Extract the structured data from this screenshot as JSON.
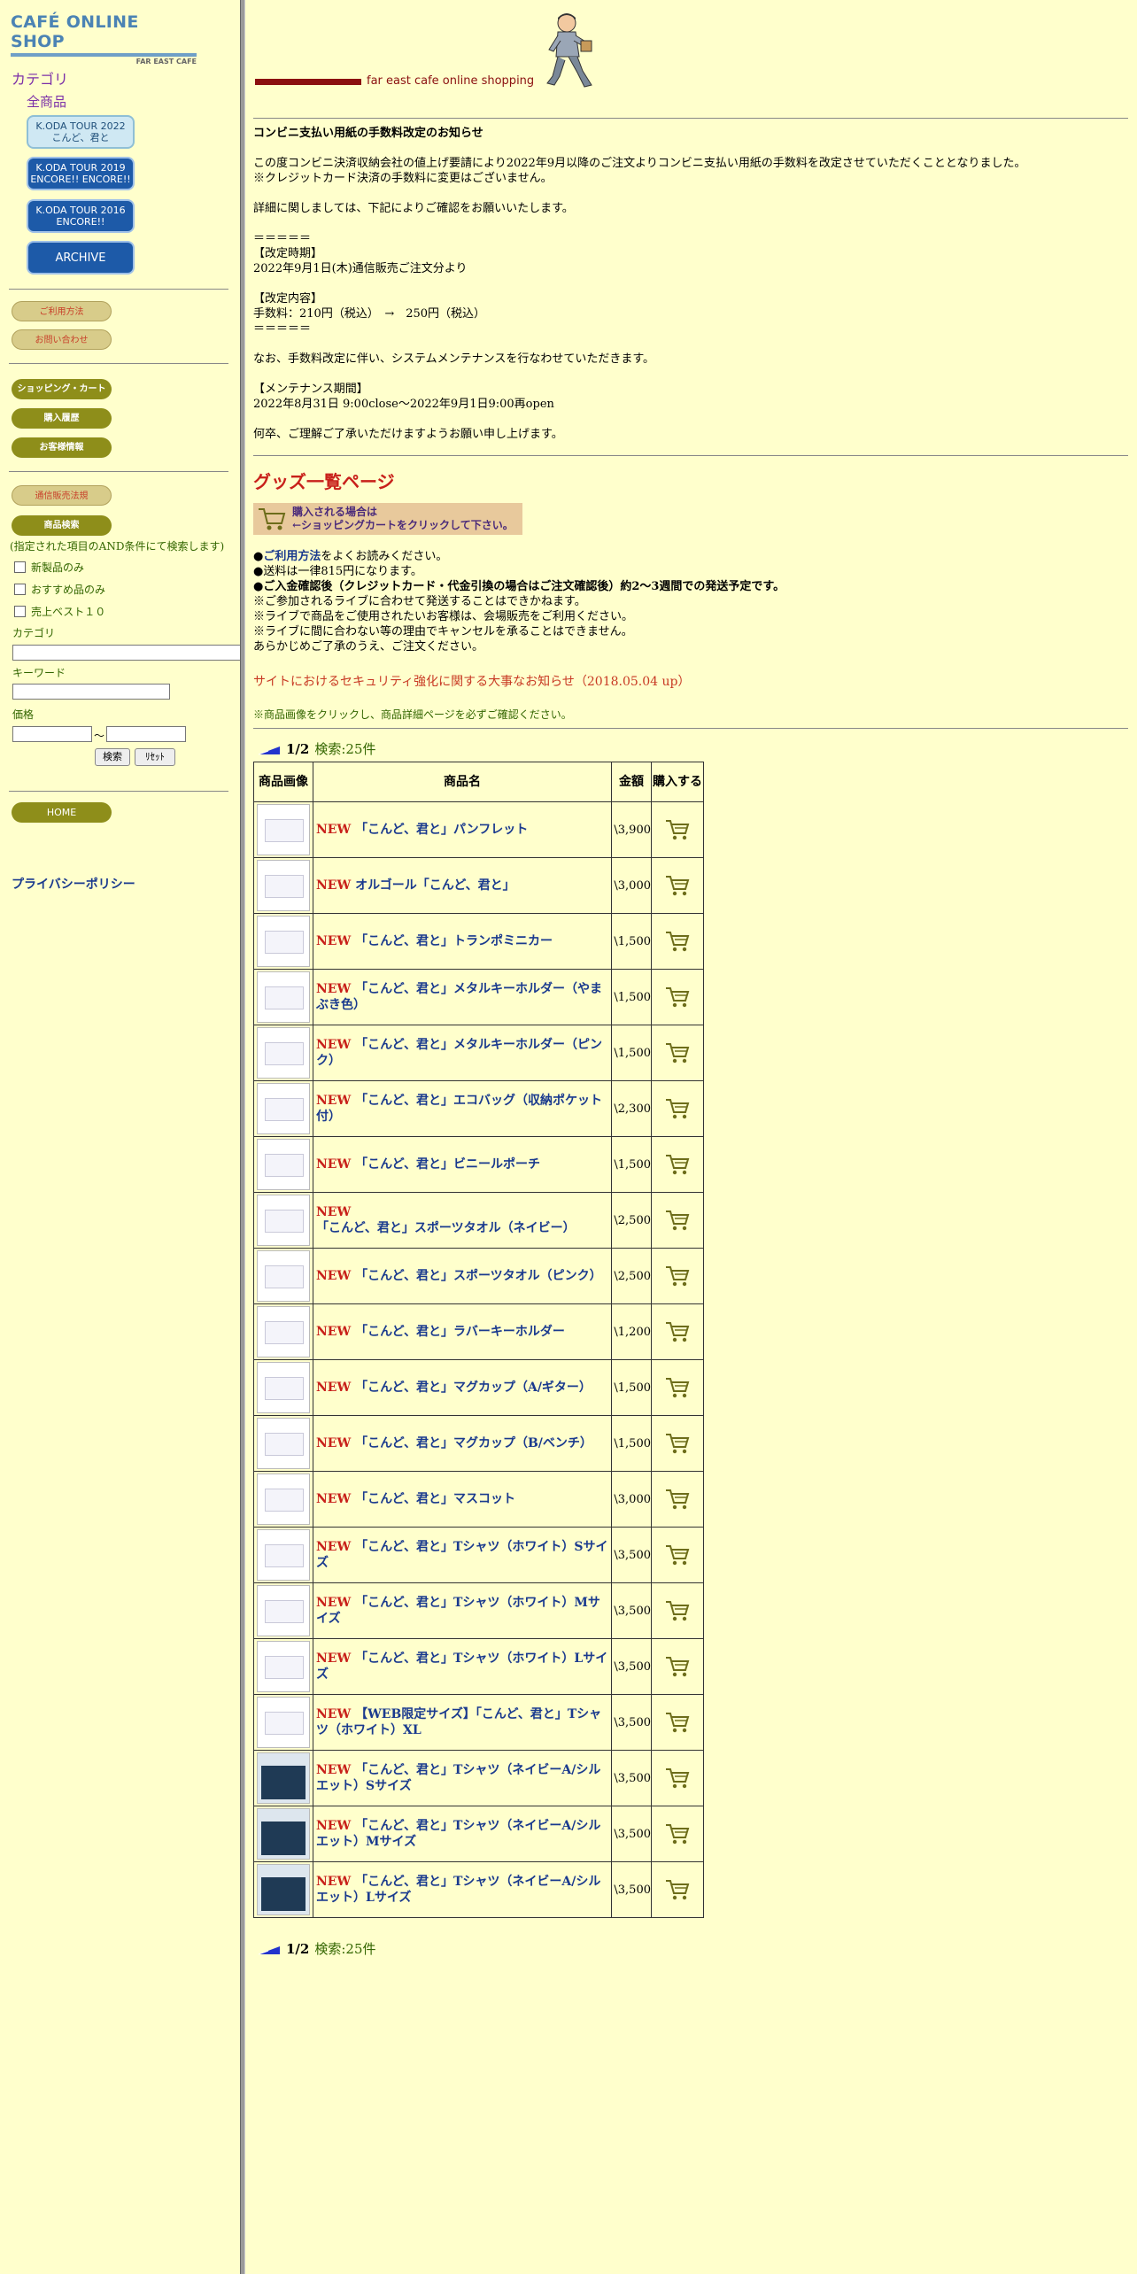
{
  "site": {
    "title": "CAFÉ ONLINE SHOP",
    "subtitle": "FAR EAST CAFE"
  },
  "sidebar": {
    "category_heading": "カテゴリ",
    "all_items": "全商品",
    "tours": [
      {
        "line1": "K.ODA TOUR 2022",
        "line2": "こんど、君と"
      },
      {
        "line1": "K.ODA TOUR 2019",
        "line2": "ENCORE!! ENCORE!!"
      },
      {
        "line1": "K.ODA TOUR 2016",
        "line2": "ENCORE!!"
      },
      {
        "line1": "ARCHIVE",
        "line2": ""
      }
    ],
    "usage": "ご利用方法",
    "contact": "お問い合わせ",
    "cart": "ショッピング・カート",
    "history": "購入履歴",
    "customer": "お客様情報",
    "law": "通信販売法規",
    "search_title": "商品検索",
    "search_note": "(指定された項目のAND条件にて検索します)",
    "checks": [
      "新製品のみ",
      "おすすめ品のみ",
      "売上ベスト１０"
    ],
    "category_label": "カテゴリ",
    "keyword_label": "キーワード",
    "price_label": "価格",
    "tilde": "～",
    "search_btn": "検索",
    "reset_btn": "ﾘｾｯﾄ",
    "home": "HOME",
    "privacy": "プライバシーポリシー"
  },
  "header": {
    "banner_text": "far east cafe online shopping"
  },
  "notice": {
    "title": "コンビニ支払い用紙の手数料改定のお知らせ",
    "lines": [
      "この度コンビニ決済収納会社の値上げ要請により2022年9月以降のご注文よりコンビニ支払い用紙の手数料を改定させていただくこととなりました。",
      "※クレジットカード決済の手数料に変更はございません。",
      "",
      "詳細に関しましては、下記によりご確認をお願いいたします。",
      "",
      "＝＝＝＝＝",
      "【改定時期】",
      "2022年9月1日(木)通信販売ご注文分より",
      "",
      "【改定内容】",
      "手数料：210円（税込）　→　250円（税込）",
      "＝＝＝＝＝",
      "",
      "なお、手数料改定に伴い、システムメンテナンスを行なわせていただきます。",
      "",
      "【メンテナンス期間】",
      "2022年8月31日 9:00close～2022年9月1日9:00再open",
      "",
      "何卒、ご理解ご了承いただけますようお願い申し上げます。"
    ]
  },
  "goods": {
    "heading": "グッズ一覧ページ",
    "cart_note1": "購入される場合は",
    "cart_note2": "←ショッピングカートをクリックして下さい。",
    "info": [
      {
        "pre": "●",
        "link": "ご利用方法",
        "post": "をよくお読みください。",
        "bold": false
      },
      {
        "pre": "●",
        "link": "",
        "post": "送料は一律815円になります。",
        "bold": false
      },
      {
        "pre": "●",
        "link": "",
        "post": "ご入金確認後（クレジットカード・代金引換の場合はご注文確認後）約2～3週間での発送予定です。",
        "bold": true
      },
      {
        "pre": "",
        "link": "",
        "post": "※ご参加されるライブに合わせて発送することはできかねます。",
        "bold": false
      },
      {
        "pre": "",
        "link": "",
        "post": "※ライブで商品をご使用されたいお客様は、会場販売をご利用ください。",
        "bold": false
      },
      {
        "pre": "",
        "link": "",
        "post": "※ライブに間に合わない等の理由でキャンセルを承ることはできません。",
        "bold": false
      },
      {
        "pre": "",
        "link": "",
        "post": "あらかじめご了承のうえ、ご注文ください。",
        "bold": false
      }
    ],
    "security": "サイトにおけるセキュリティ強化に関する大事なお知らせ（2018.05.04 up）",
    "note": "※商品画像をクリックし、商品詳細ページを必ずご確認ください。",
    "pager": {
      "page": "1/2",
      "count": "検索:25件"
    },
    "columns": [
      "商品画像",
      "商品名",
      "金額",
      "購入する"
    ],
    "new_label": "NEW",
    "products": [
      {
        "name": "「こんど、君と」パンフレット",
        "price": "\\3,900"
      },
      {
        "name": "オルゴール「こんど、君と」",
        "price": "\\3,000"
      },
      {
        "name": "「こんど、君と」トランポミニカー",
        "price": "\\1,500"
      },
      {
        "name": "「こんど、君と」メタルキーホルダー（やまぶき色）",
        "price": "\\1,500"
      },
      {
        "name": "「こんど、君と」メタルキーホルダー（ピンク）",
        "price": "\\1,500"
      },
      {
        "name": "「こんど、君と」エコバッグ（収納ポケット付）",
        "price": "\\2,300"
      },
      {
        "name": "「こんど、君と」ビニールポーチ",
        "price": "\\1,500"
      },
      {
        "name": "「こんど、君と」スポーツタオル（ネイビー）",
        "price": "\\2,500"
      },
      {
        "name": "「こんど、君と」スポーツタオル（ピンク）",
        "price": "\\2,500"
      },
      {
        "name": "「こんど、君と」ラバーキーホルダー",
        "price": "\\1,200"
      },
      {
        "name": "「こんど、君と」マグカップ（A/ギター）",
        "price": "\\1,500"
      },
      {
        "name": "「こんど、君と」マグカップ（B/ベンチ）",
        "price": "\\1,500"
      },
      {
        "name": "「こんど、君と」マスコット",
        "price": "\\3,000"
      },
      {
        "name": "「こんど、君と」Tシャツ（ホワイト）Sサイズ",
        "price": "\\3,500"
      },
      {
        "name": "「こんど、君と」Tシャツ（ホワイト）Mサイズ",
        "price": "\\3,500"
      },
      {
        "name": "「こんど、君と」Tシャツ（ホワイト）Lサイズ",
        "price": "\\3,500"
      },
      {
        "name": "【WEB限定サイズ】「こんど、君と」Tシャツ（ホワイト）XL",
        "price": "\\3,500"
      },
      {
        "name": "「こんど、君と」Tシャツ（ネイビーA/シルエット）Sサイズ",
        "price": "\\3,500"
      },
      {
        "name": "「こんど、君と」Tシャツ（ネイビーA/シルエット）Mサイズ",
        "price": "\\3,500"
      },
      {
        "name": "「こんど、君と」Tシャツ（ネイビーA/シルエット）Lサイズ",
        "price": "\\3,500"
      }
    ]
  }
}
